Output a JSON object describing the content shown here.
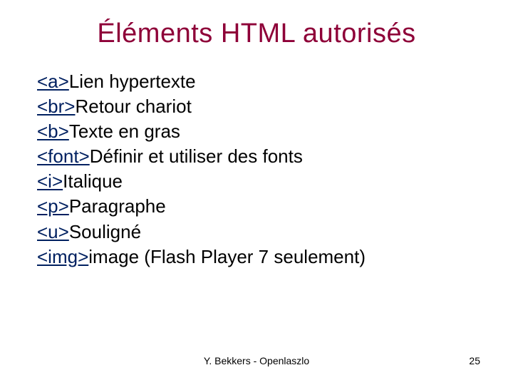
{
  "title": "Éléments HTML autorisés",
  "items": [
    {
      "tag": "<a>",
      "desc": "Lien hypertexte"
    },
    {
      "tag": "<br>",
      "desc": "Retour chariot"
    },
    {
      "tag": "<b>",
      "desc": "Texte en gras"
    },
    {
      "tag": "<font>",
      "desc": "Définir et utiliser des fonts"
    },
    {
      "tag": "<i>",
      "desc": "Italique"
    },
    {
      "tag": "<p>",
      "desc": "Paragraphe"
    },
    {
      "tag": "<u>",
      "desc": "Souligné"
    },
    {
      "tag": "<img>",
      "desc": "image (Flash Player 7 seulement)"
    }
  ],
  "footer": {
    "author": "Y. Bekkers - Openlaszlo",
    "page": "25"
  }
}
